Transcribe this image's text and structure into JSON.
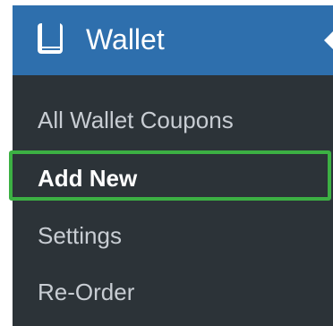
{
  "menu": {
    "title": "Wallet",
    "icon": "wallet-book-icon",
    "colors": {
      "header_bg": "#2e6fad",
      "menu_bg": "#2c3338",
      "text": "#c8cdd3",
      "active_text": "#ffffff",
      "highlight": "#3cb043"
    },
    "items": [
      {
        "label": "All Wallet Coupons"
      },
      {
        "label": "Add New",
        "active": true
      },
      {
        "label": "Settings"
      },
      {
        "label": "Re-Order"
      }
    ]
  }
}
